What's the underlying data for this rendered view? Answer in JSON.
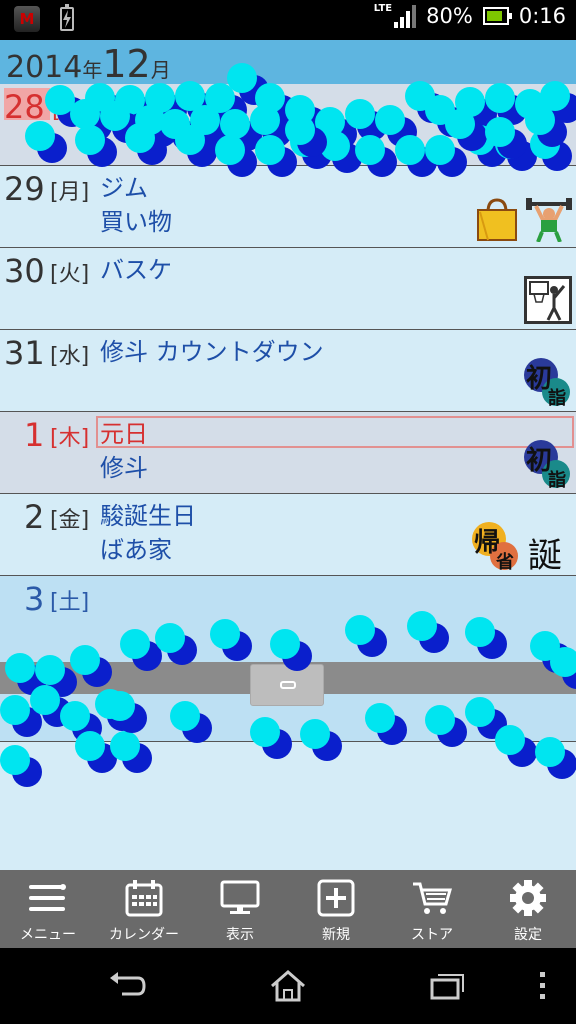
{
  "status_bar": {
    "network": "LTE",
    "battery_percent": "80%",
    "time": "0:16",
    "colors": {
      "battery_fill": "#7ec700",
      "mcafee": "#cc0000"
    }
  },
  "header": {
    "year": "2014",
    "year_suffix": "年",
    "month": "12",
    "month_suffix": "月"
  },
  "days": [
    {
      "day": "28",
      "dow": "[日]",
      "events": [],
      "today": true
    },
    {
      "day": "29",
      "dow": "[月]",
      "events": [
        "ジム",
        "買い物"
      ],
      "icons": [
        "shopping-bag-icon",
        "weightlifting-icon"
      ]
    },
    {
      "day": "30",
      "dow": "[火]",
      "events": [
        "バスケ"
      ],
      "icons": [
        "basketball-icon"
      ]
    },
    {
      "day": "31",
      "dow": "[水]",
      "events": [
        "修斗 カウントダウン"
      ],
      "icons": [
        "hatsumode-icon"
      ]
    },
    {
      "day": "1",
      "dow": "[木]",
      "events": [
        "元日",
        "修斗"
      ],
      "holiday": true,
      "icons": [
        "hatsumode-icon"
      ]
    },
    {
      "day": "2",
      "dow": "[金]",
      "events": [
        "駿誕生日",
        "ばあ家"
      ],
      "icons": [
        "kisei-icon",
        "birthday-icon"
      ]
    },
    {
      "day": "3",
      "dow": "[土]",
      "events": []
    }
  ],
  "badges": {
    "hatsu_top": "初",
    "hatsu_bottom": "詣",
    "ki_top": "帰",
    "ki_bottom": "省",
    "tan": "誕"
  },
  "toolbar": {
    "menu": "メニュー",
    "calendar": "カレンダー",
    "display": "表示",
    "new": "新規",
    "store": "ストア",
    "settings": "設定"
  },
  "colors": {
    "background": "#d5ecf7",
    "header": "#5eb5e0",
    "event_text": "#1e4fa8",
    "sunday": "#d63030",
    "saturday": "#2b5aa8",
    "toolbar": "#6a6a6a",
    "overlay_dot_light": "#00e5f0",
    "overlay_dot_dark": "#0a1fcc"
  }
}
